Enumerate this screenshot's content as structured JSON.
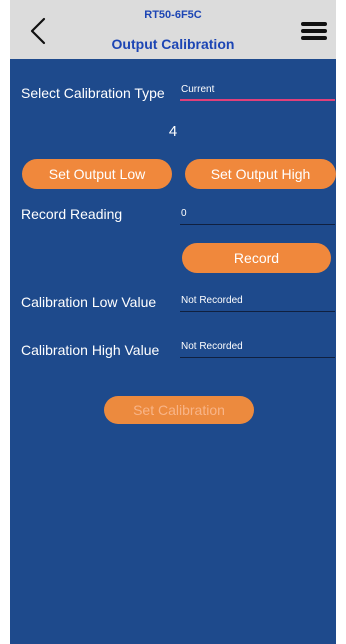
{
  "header": {
    "device_name": "RT50-6F5C",
    "title": "Output Calibration"
  },
  "form": {
    "calibration_type_label": "Select Calibration Type",
    "calibration_type_value": "Current",
    "current_step": "4",
    "set_output_low_label": "Set Output Low",
    "set_output_high_label": "Set Output High",
    "record_reading_label": "Record Reading",
    "record_reading_value": "0",
    "record_label": "Record",
    "cal_low_label": "Calibration Low Value",
    "cal_low_value": "Not Recorded",
    "cal_high_label": "Calibration High Value",
    "cal_high_value": "Not Recorded",
    "set_calibration_label": "Set Calibration"
  },
  "colors": {
    "header_bg": "#dcdcdc",
    "accent_blue": "#1c45b4",
    "panel_bg": "#1e4a8c",
    "button_orange": "#f0883c",
    "active_underline": "#e0407a"
  },
  "icons": {
    "back": "chevron-left-icon",
    "menu": "hamburger-menu-icon"
  }
}
